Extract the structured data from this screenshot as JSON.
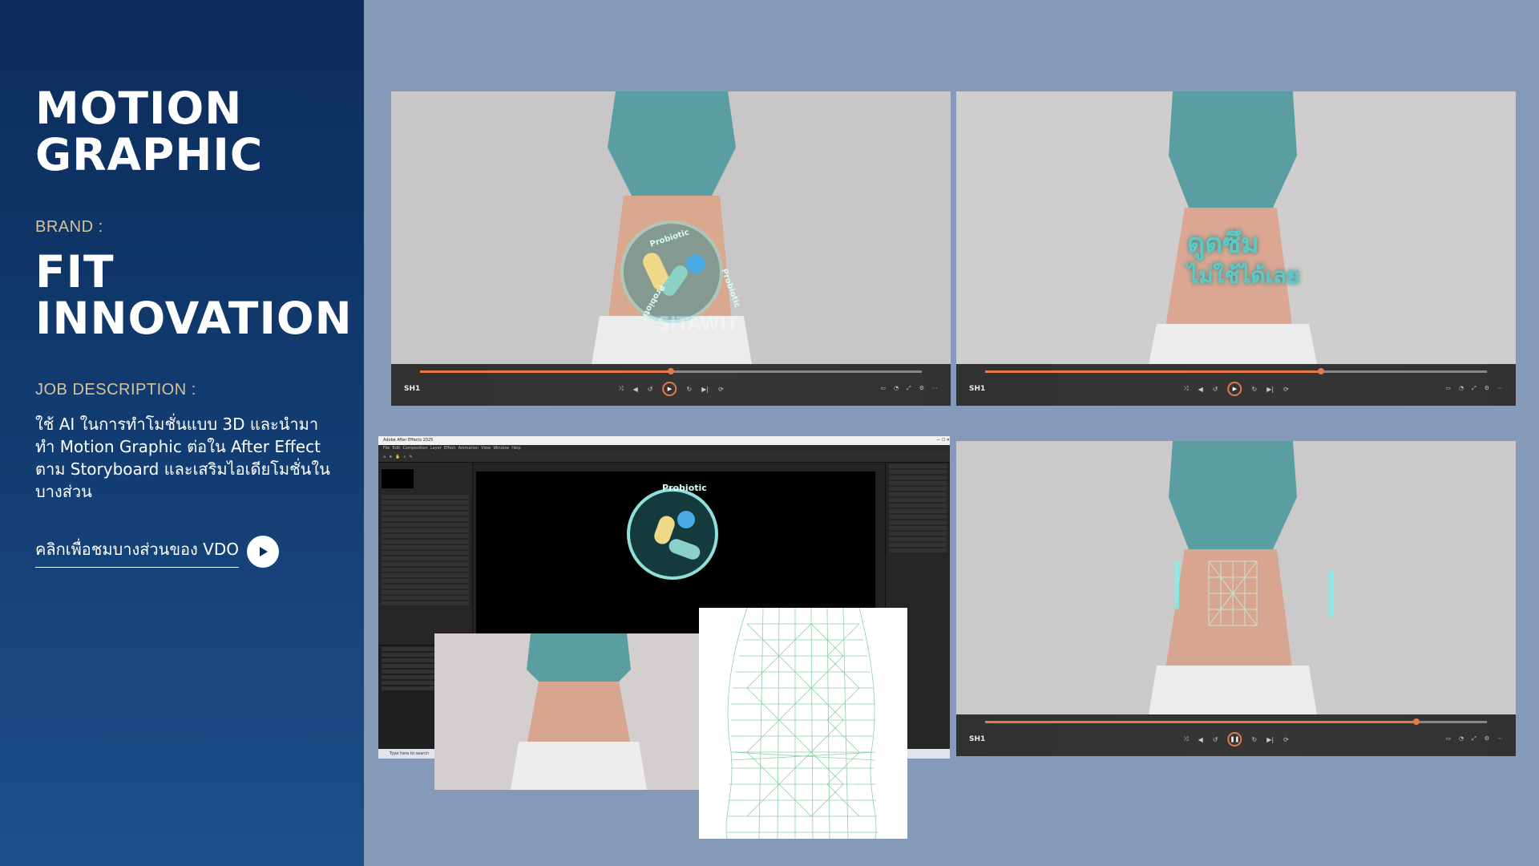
{
  "sidebar": {
    "title_line1": "MOTION",
    "title_line2": "GRAPHIC",
    "brand_label": "BRAND :",
    "brand_line1": "FIT",
    "brand_line2": "INNOVATION",
    "job_label": "JOB DESCRIPTION :",
    "job_description": "ใช้ AI ในการทำโมชั่นแบบ 3D และนำมาทำ Motion Graphic ต่อใน After Effect ตาม Storyboard และเสริมไอเดียโมชั่นในบางส่วน",
    "vdo_link_label": "คลิกเพื่อชมบางส่วนของ VDO",
    "play_icon": "play-circle-icon"
  },
  "frames": [
    {
      "overlay_text": [
        "Probiotic",
        "Probiotic",
        "Probiotic"
      ],
      "watermark": "SITAWIT",
      "player": {
        "clip_name": "SH1",
        "progress": 0.5,
        "playing": false
      }
    },
    {
      "overlay_text": [
        "ดูดซึม",
        "ไม่ใช้ได้เลย"
      ],
      "player": {
        "clip_name": "SH1",
        "progress": 0.67,
        "playing": false
      }
    },
    {
      "player": {
        "clip_name": "SH1",
        "progress": 0.86,
        "playing": true
      }
    }
  ],
  "after_effects": {
    "window_title": "Adobe After Effects 2025",
    "menu": [
      "File",
      "Edit",
      "Composition",
      "Layer",
      "Effect",
      "Animation",
      "View",
      "Window",
      "Help"
    ],
    "comp_label": "Probiotic",
    "taskbar_search": "Type here to search"
  },
  "colors": {
    "page_bg": "#8599b8",
    "sidebar_bg": "#0b2c5c",
    "label_gold": "#d7c39d",
    "player_accent": "#e8774a",
    "teal_overlay": "#5fc9c4"
  }
}
